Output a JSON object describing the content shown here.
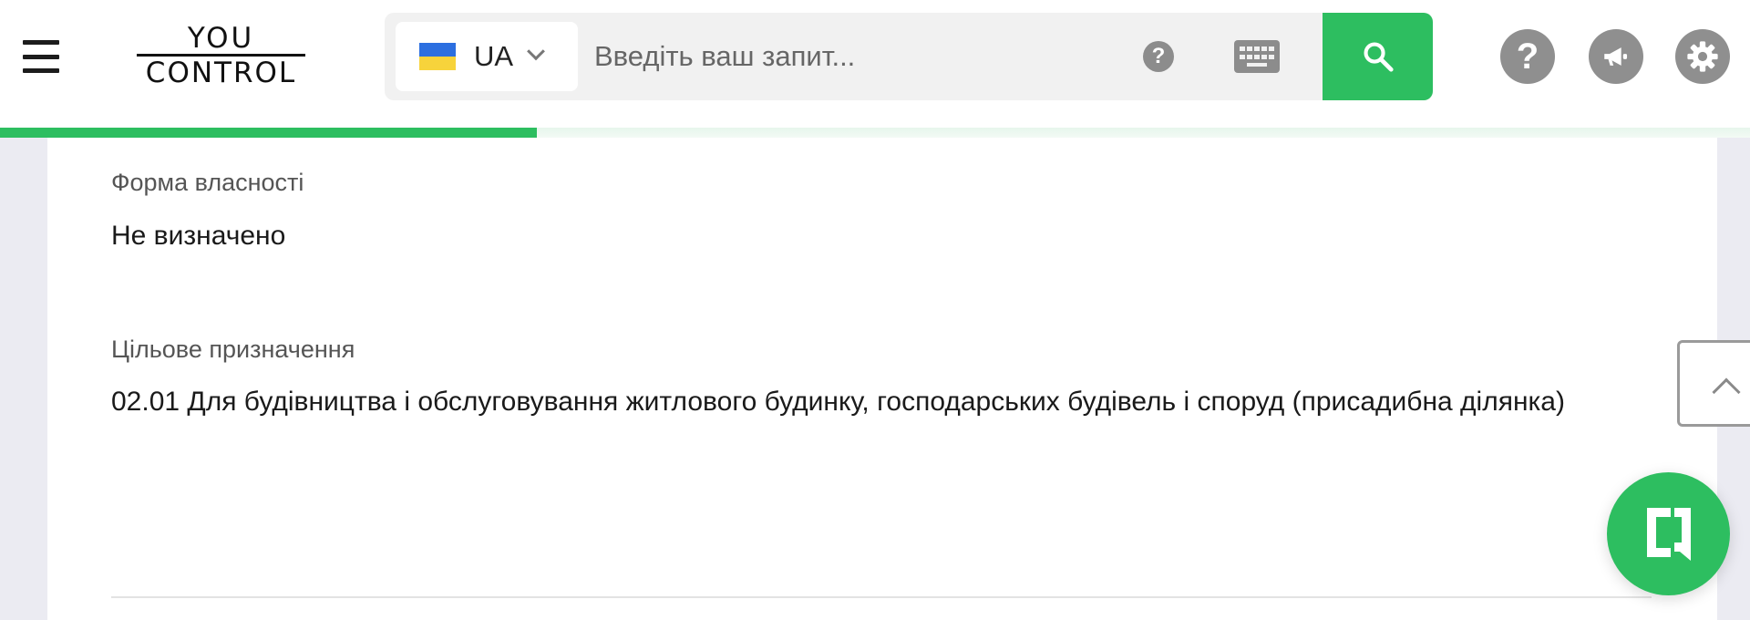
{
  "header": {
    "logo_top": "YOU",
    "logo_bottom": "CONTROL",
    "language": "UA",
    "search_placeholder": "Введіть ваш запит...",
    "help_small": "?",
    "help_circle": "?"
  },
  "colors": {
    "accent": "#2dbe60",
    "icon_gray": "#8f8f8f",
    "page_bg": "#ebebf2"
  },
  "progress": {
    "fraction": 0.307
  },
  "details": {
    "ownership_label": "Форма власності",
    "ownership_value": "Не визначено",
    "purpose_label": "Цільове призначення",
    "purpose_value": "02.01 Для будівництва і обслуговування житлового будинку, господарських будівель і споруд (присадибна ділянка)"
  }
}
